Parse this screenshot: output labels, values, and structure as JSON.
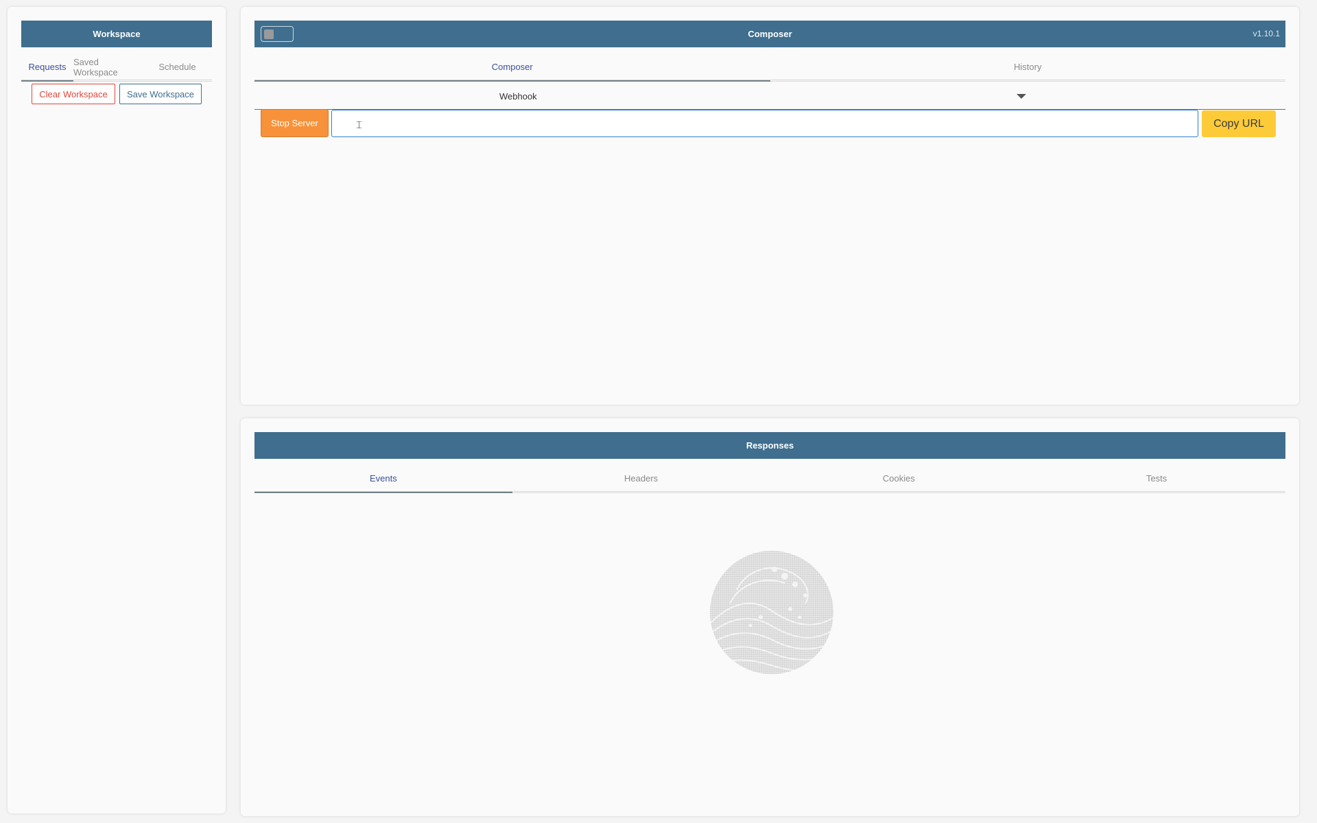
{
  "sidebar": {
    "title": "Workspace",
    "tabs": [
      {
        "label": "Requests",
        "active": true
      },
      {
        "label": "Saved Workspace",
        "active": false
      },
      {
        "label": "Schedule",
        "active": false
      }
    ],
    "clear_label": "Clear Workspace",
    "save_label": "Save Workspace"
  },
  "composer": {
    "title": "Composer",
    "version": "v1.10.1",
    "tabs": [
      {
        "label": "Composer",
        "active": true
      },
      {
        "label": "History",
        "active": false
      }
    ],
    "protocol": "Webhook",
    "stop_label": "Stop Server",
    "url_value": "",
    "copy_label": "Copy URL"
  },
  "responses": {
    "title": "Responses",
    "tabs": [
      {
        "label": "Events",
        "active": true
      },
      {
        "label": "Headers",
        "active": false
      },
      {
        "label": "Cookies",
        "active": false
      },
      {
        "label": "Tests",
        "active": false
      }
    ]
  },
  "colors": {
    "header": "#3f6e8e",
    "danger": "#e0453a",
    "stop": "#f7923a",
    "copy": "#fdcb38",
    "active_tab": "#3a4f9b"
  },
  "icons": {
    "caret": "chevron-down-icon",
    "cursor": "text-cursor-icon",
    "logo": "wave-logo-icon"
  }
}
